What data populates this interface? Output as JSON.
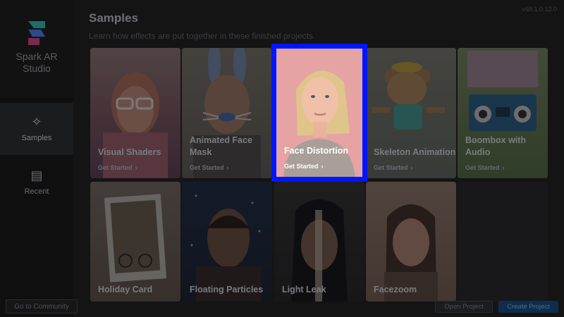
{
  "sidebar": {
    "brand_line1": "Spark AR",
    "brand_line2": "Studio",
    "items": [
      {
        "label": "Samples",
        "icon": "sparkle-icon"
      },
      {
        "label": "Recent",
        "icon": "document-icon"
      }
    ],
    "community_label": "Go to Community"
  },
  "header": {
    "title": "Samples",
    "subtitle": "Learn how effects are put together in these finished projects",
    "version": "v68.1.0.12.0"
  },
  "cards": [
    {
      "title": "Visual Shaders",
      "cta": "Get Started"
    },
    {
      "title": "Animated Face Mask",
      "cta": "Get Started"
    },
    {
      "title": "Face Distortion",
      "cta": "Get Started"
    },
    {
      "title": "Skeleton Animation",
      "cta": "Get Started"
    },
    {
      "title": "Boombox with Audio",
      "cta": "Get Started"
    },
    {
      "title": "Holiday Card"
    },
    {
      "title": "Floating Particles"
    },
    {
      "title": "Light Leak"
    },
    {
      "title": "Facezoom"
    }
  ],
  "footer": {
    "open_label": "Open Project",
    "create_label": "Create Project"
  },
  "colors": {
    "highlight": "#0016ff",
    "face_distortion_bg": "#e6a3a4"
  }
}
